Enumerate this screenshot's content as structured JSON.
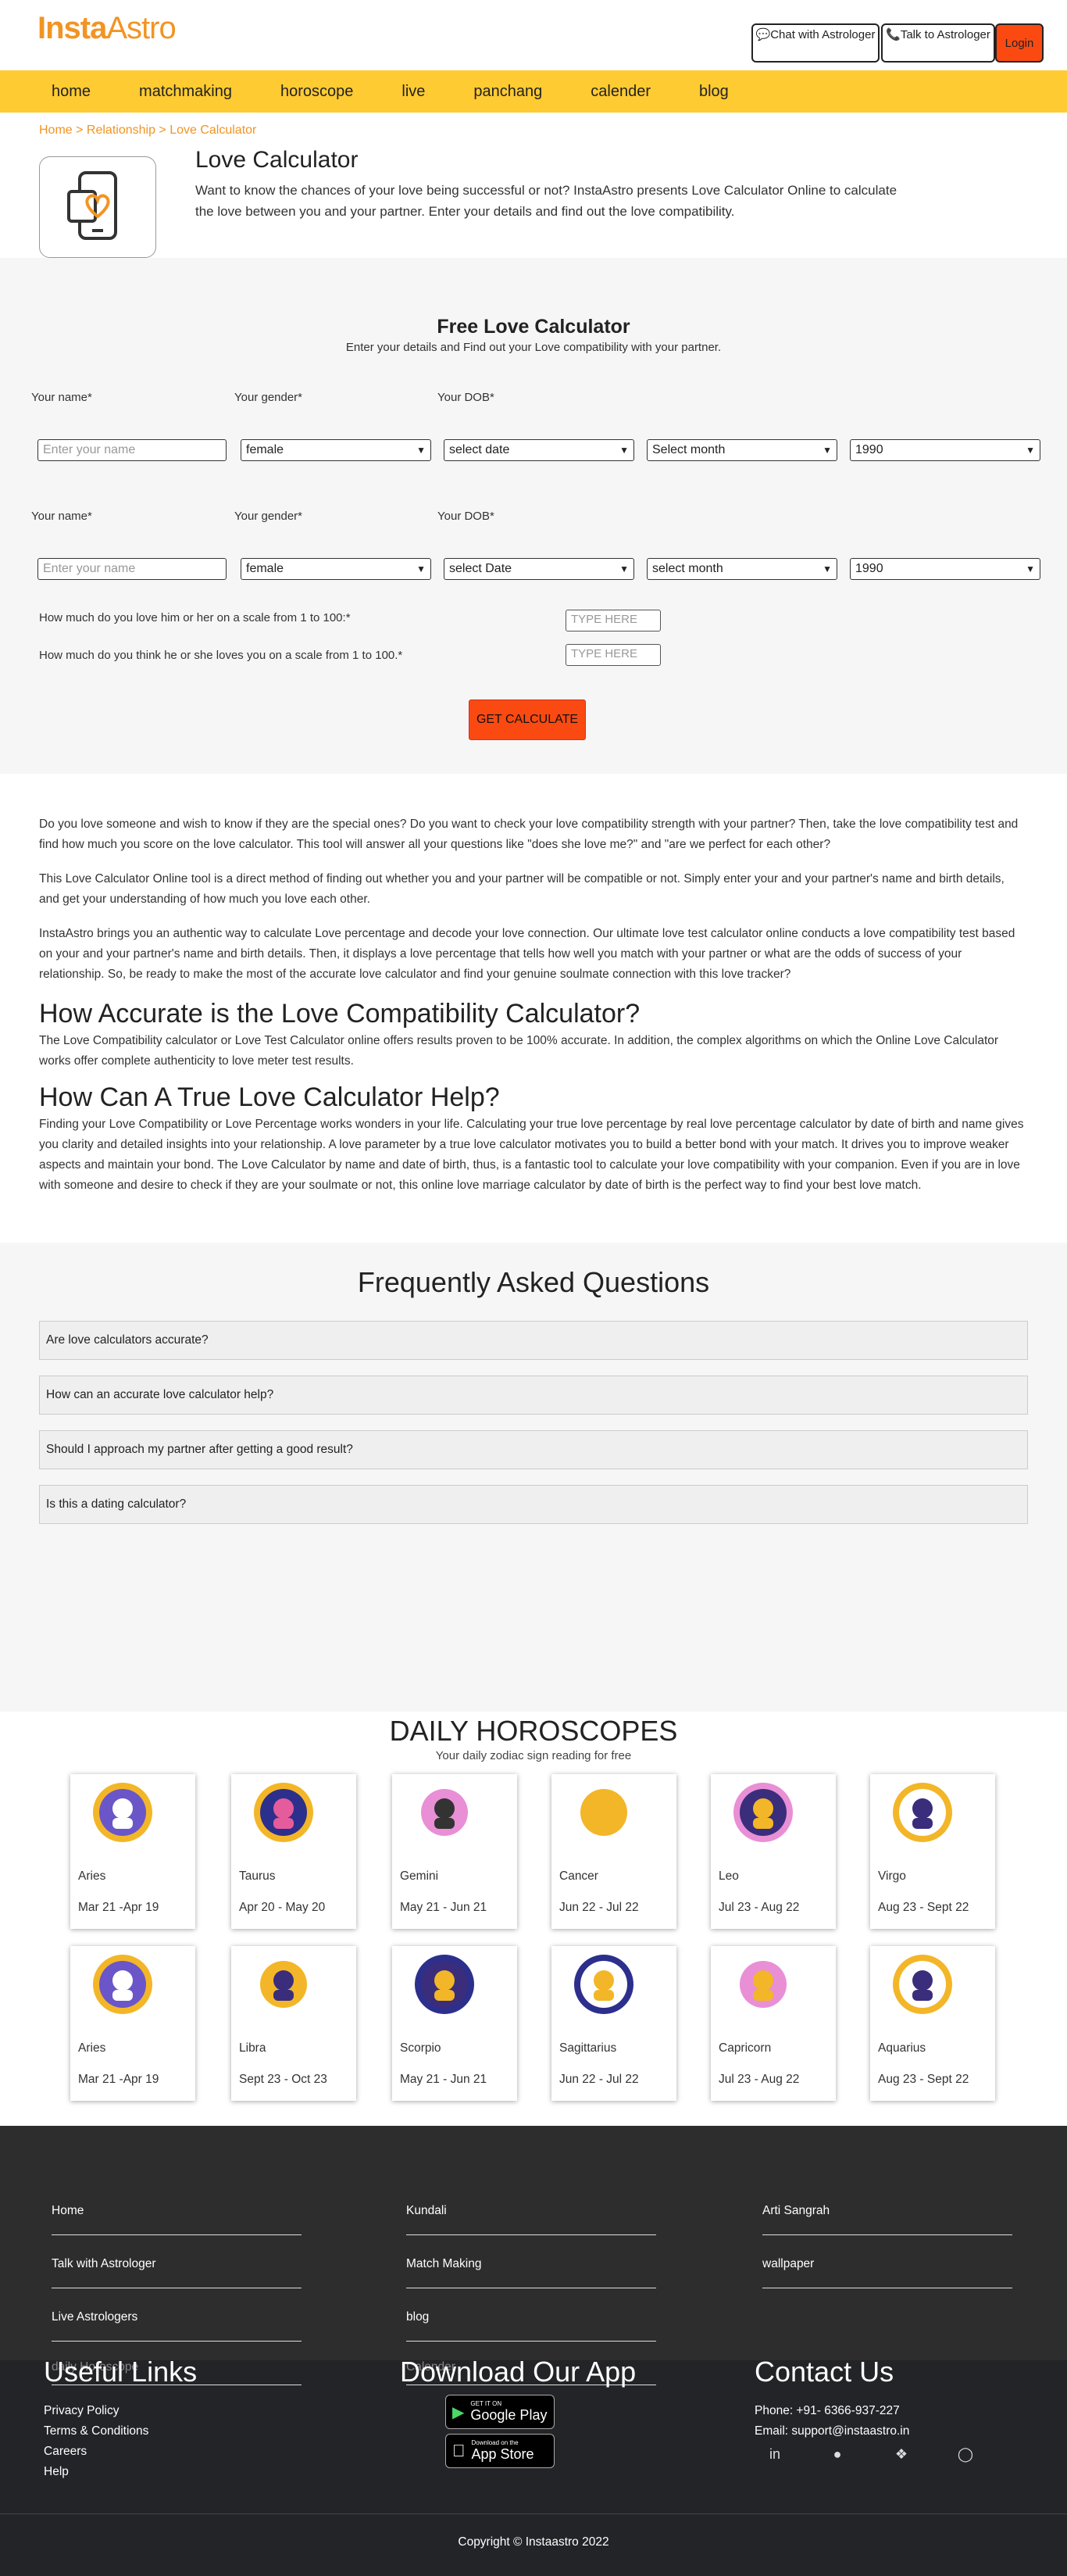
{
  "header": {
    "logo_part1": "Insta",
    "logo_part2": "Astro",
    "chat_button": "Chat with Astrologer",
    "talk_button": "Talk to Astrologer",
    "login_button": "Login"
  },
  "nav": [
    "home",
    "matchmaking",
    "horoscope",
    "live",
    "panchang",
    "calender",
    "blog"
  ],
  "breadcrumb": "Home > Relationship > Love Calculator",
  "hero": {
    "title": "Love Calculator",
    "description": "Want to know the chances of your love being successful or not? InstaAstro presents Love Calculator Online to calculate the love between you and your partner. Enter your details and find out the love compatibility."
  },
  "calculator": {
    "title": "Free Love Calculator",
    "subtitle": "Enter your details and Find out your Love compatibility with your partner.",
    "label_name": "Your name*",
    "label_gender": "Your gender*",
    "label_dob": "Your DOB*",
    "name_placeholder": "Enter your name",
    "person1": {
      "gender": "female",
      "date": "select date",
      "month": "Select month",
      "year": "1990"
    },
    "person2": {
      "gender": "female",
      "date": "select Date",
      "month": "select month",
      "year": "1990"
    },
    "question1": "How much do you love him or her on a scale from 1 to 100:*",
    "question2": "How much do you think he or she loves you on a scale from 1 to 100.*",
    "type_here": "TYPE HERE",
    "submit": "GET CALCULATE"
  },
  "article": {
    "p1": "Do you love someone and wish to know if they are the special ones? Do you want to check your love compatibility strength with your partner? Then, take the love compatibility test and find how much you score on the love calculator. This tool will answer all your questions like \"does she love me?\" and \"are we perfect for each other?",
    "p2": "This Love Calculator Online tool is a direct method of finding out whether you and your partner will be compatible or not. Simply enter your and your partner's name and birth details, and get your understanding of how much you love each other.",
    "p3": "InstaAstro brings you an authentic way to calculate Love percentage and decode your love connection. Our ultimate love test calculator online conducts a love compatibility test based on your and your partner's name and birth details. Then, it displays a love percentage that tells how well you match with your partner or what are the odds of success of your relationship. So, be ready to make the most of the accurate love calculator and find your genuine soulmate connection with this love tracker?",
    "h1": "How Accurate is the Love Compatibility Calculator?",
    "p4": "The Love Compatibility calculator or Love Test Calculator online offers results proven to be 100% accurate. In addition, the complex algorithms on which the Online Love Calculator works offer complete authenticity to love meter test results.",
    "h2": "How Can A True Love Calculator Help?",
    "p5": "Finding your Love Compatibility or Love Percentage works wonders in your life. Calculating your true love percentage by real love percentage calculator by date of birth and name gives you clarity and detailed insights into your relationship. A love parameter by a true love calculator motivates you to build a better bond with your match. It drives you to improve weaker aspects and maintain your bond. The Love Calculator by name and date of birth, thus, is a fantastic tool to calculate your love compatibility with your companion. Even if you are in love with someone and desire to check if they are your soulmate or not, this online love marriage calculator by date of birth is the perfect way to find your best love match."
  },
  "faq": {
    "title": "Frequently Asked Questions",
    "items": [
      "Are love calculators accurate?",
      "How can an accurate love calculator help?",
      "Should I approach my partner after getting a good result?",
      "Is this a dating calculator?"
    ]
  },
  "horoscopes": {
    "title": "DAILY HOROSCOPES",
    "subtitle": "Your daily zodiac sign reading for free",
    "signs": [
      {
        "name": "Aries",
        "dates": "Mar 21 -Apr 19",
        "icon": "aries-icon"
      },
      {
        "name": "Taurus",
        "dates": "Apr 20 - May 20",
        "icon": "taurus-icon"
      },
      {
        "name": "Gemini",
        "dates": "May 21 - Jun 21",
        "icon": "gemini-icon"
      },
      {
        "name": "Cancer",
        "dates": "Jun 22 - Jul 22",
        "icon": "cancer-icon"
      },
      {
        "name": "Leo",
        "dates": "Jul 23 - Aug 22",
        "icon": "leo-icon"
      },
      {
        "name": "Virgo",
        "dates": "Aug 23 - Sept 22",
        "icon": "virgo-icon"
      },
      {
        "name": "Aries",
        "dates": "Mar 21 -Apr 19",
        "icon": "aries-icon"
      },
      {
        "name": "Libra",
        "dates": "Sept 23 - Oct 23",
        "icon": "libra-icon"
      },
      {
        "name": "Scorpio",
        "dates": "May 21 - Jun 21",
        "icon": "scorpio-icon"
      },
      {
        "name": "Sagittarius",
        "dates": "Jun 22 - Jul 22",
        "icon": "sagittarius-icon"
      },
      {
        "name": "Capricorn",
        "dates": "Jul 23 - Aug 22",
        "icon": "capricorn-icon"
      },
      {
        "name": "Aquarius",
        "dates": "Aug 23 - Sept 22",
        "icon": "aquarius-icon"
      }
    ]
  },
  "footer": {
    "links_col1": [
      "Home",
      "Talk with Astrologer",
      "Live Astrologers",
      "daily Horoscope"
    ],
    "links_col2": [
      "Kundali",
      "Match Making",
      "blog",
      "Calender"
    ],
    "links_col3": [
      "Arti Sangrah",
      "wallpaper"
    ],
    "useful_title": "Useful Links",
    "useful_links": [
      "Privacy Policy",
      "Terms & Conditions",
      "Careers",
      "Help"
    ],
    "download_title": "Download Our App",
    "google_small": "GET IT ON",
    "google_big": "Google Play",
    "apple_small": "Download on the",
    "apple_big": "App Store",
    "contact_title": "Contact Us",
    "phone": "Phone: +91- 6366-937-227",
    "email": "Email: support@instaastro.in",
    "copyright": "Copyright © Instaastro 2022"
  },
  "colors": {
    "accent": "#f29423",
    "nav": "#ffcb32",
    "cta": "#fa4a12"
  }
}
